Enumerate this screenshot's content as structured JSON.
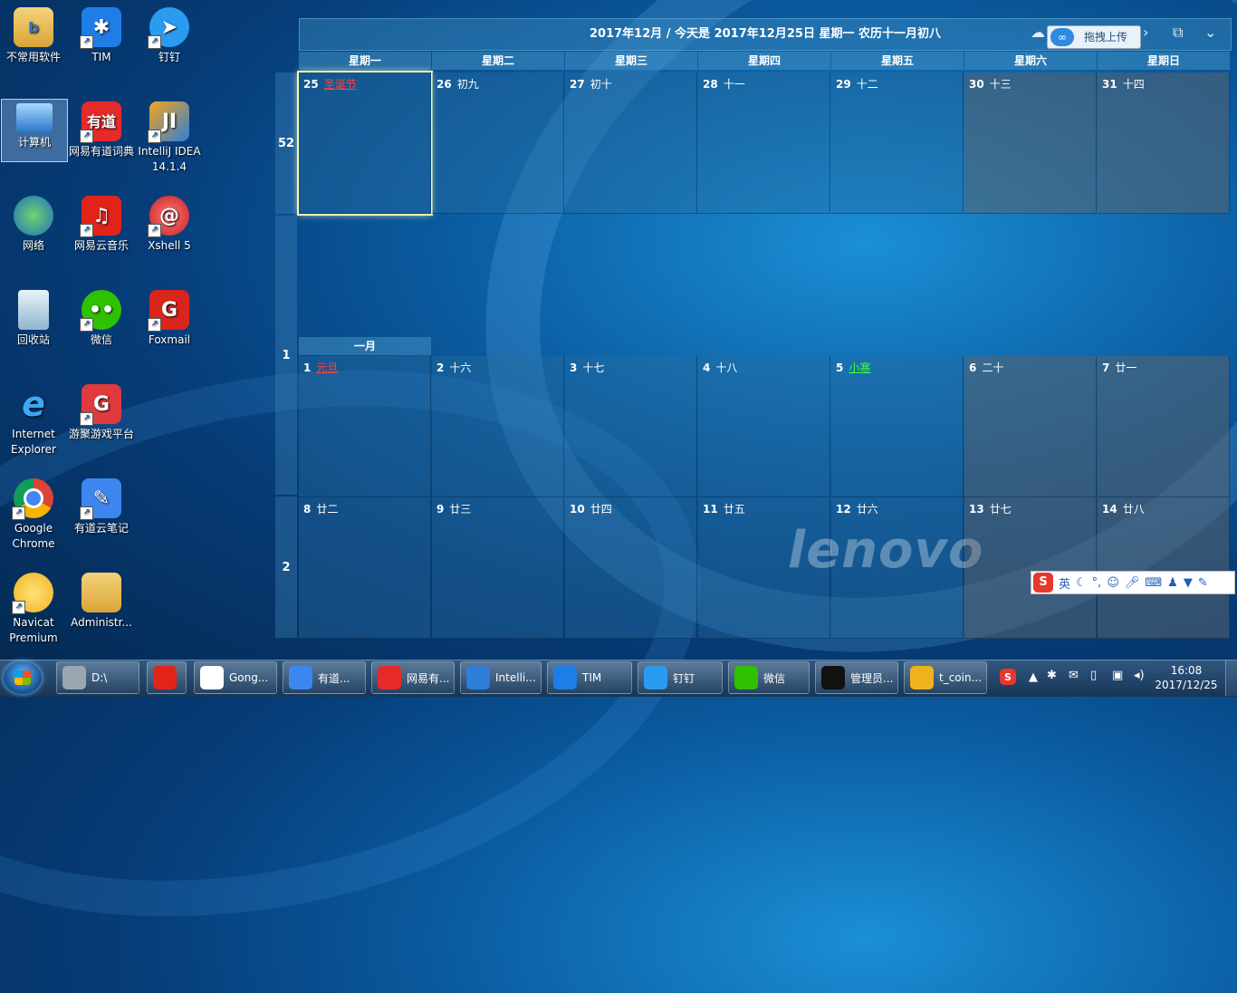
{
  "desktop_icons": [
    {
      "label": "不常用软件",
      "icon": "folder-icon"
    },
    {
      "label": "TIM",
      "icon": "tim-icon"
    },
    {
      "label": "钉钉",
      "icon": "dingtalk-icon"
    },
    {
      "label": "计算机",
      "icon": "computer-icon"
    },
    {
      "label": "网易有道词典",
      "icon": "youdao-dict-icon"
    },
    {
      "label": "IntelliJ IDEA 14.1.4",
      "icon": "intellij-icon"
    },
    {
      "label": "网络",
      "icon": "network-icon"
    },
    {
      "label": "网易云音乐",
      "icon": "netease-music-icon"
    },
    {
      "label": "Xshell 5",
      "icon": "xshell-icon"
    },
    {
      "label": "回收站",
      "icon": "recycle-bin-icon"
    },
    {
      "label": "微信",
      "icon": "wechat-icon"
    },
    {
      "label": "Foxmail",
      "icon": "foxmail-icon"
    },
    {
      "label": "Internet Explorer",
      "icon": "ie-icon"
    },
    {
      "label": "游聚游戏平台",
      "icon": "youju-icon"
    },
    {
      "label": "Google Chrome",
      "icon": "chrome-icon"
    },
    {
      "label": "有道云笔记",
      "icon": "youdao-note-icon"
    },
    {
      "label": "Navicat Premium",
      "icon": "navicat-icon"
    },
    {
      "label": "Administr...",
      "icon": "user-folder-icon"
    }
  ],
  "calendar": {
    "header": "2017年12月 / 今天是 2017年12月25日 星期一 农历十一月初八",
    "weekdays": [
      "星期一",
      "星期二",
      "星期三",
      "星期四",
      "星期五",
      "星期六",
      "星期日"
    ],
    "month_label": "一月",
    "weeks": [
      {
        "num": "52",
        "days": [
          {
            "d": "25",
            "l": "圣诞节",
            "style": "red"
          },
          {
            "d": "26",
            "l": "初九"
          },
          {
            "d": "27",
            "l": "初十"
          },
          {
            "d": "28",
            "l": "十一"
          },
          {
            "d": "29",
            "l": "十二"
          },
          {
            "d": "30",
            "l": "十三"
          },
          {
            "d": "31",
            "l": "十四"
          }
        ]
      },
      {
        "num": "1",
        "days": [
          {
            "d": "1",
            "l": "元旦",
            "style": "red"
          },
          {
            "d": "2",
            "l": "十六"
          },
          {
            "d": "3",
            "l": "十七"
          },
          {
            "d": "4",
            "l": "十八"
          },
          {
            "d": "5",
            "l": "小寒",
            "style": "green"
          },
          {
            "d": "6",
            "l": "二十"
          },
          {
            "d": "7",
            "l": "廿一"
          }
        ]
      },
      {
        "num": "2",
        "days": [
          {
            "d": "8",
            "l": "廿二"
          },
          {
            "d": "9",
            "l": "廿三"
          },
          {
            "d": "10",
            "l": "廿四"
          },
          {
            "d": "11",
            "l": "廿五"
          },
          {
            "d": "12",
            "l": "廿六"
          },
          {
            "d": "13",
            "l": "廿七"
          },
          {
            "d": "14",
            "l": "廿八"
          }
        ]
      }
    ]
  },
  "upload_button": "拖拽上传",
  "wallpaper_brand": "lenovo",
  "ime": {
    "mode": "英"
  },
  "taskbar": {
    "items": [
      {
        "label": "D:\\",
        "icon": "drive-icon"
      },
      {
        "label": "",
        "icon": "netease-music-icon"
      },
      {
        "label": "Gong...",
        "icon": "chrome-icon"
      },
      {
        "label": "有道...",
        "icon": "youdao-note-icon"
      },
      {
        "label": "网易有...",
        "icon": "youdao-dict-icon"
      },
      {
        "label": "Intelli...",
        "icon": "intellij-icon"
      },
      {
        "label": "TIM",
        "icon": "tim-icon"
      },
      {
        "label": "钉钉",
        "icon": "dingtalk-icon"
      },
      {
        "label": "微信",
        "icon": "wechat-icon"
      },
      {
        "label": "管理员...",
        "icon": "cmd-icon"
      },
      {
        "label": "t_coin...",
        "icon": "navicat-icon"
      }
    ],
    "time": "16:08",
    "date": "2017/12/25"
  }
}
